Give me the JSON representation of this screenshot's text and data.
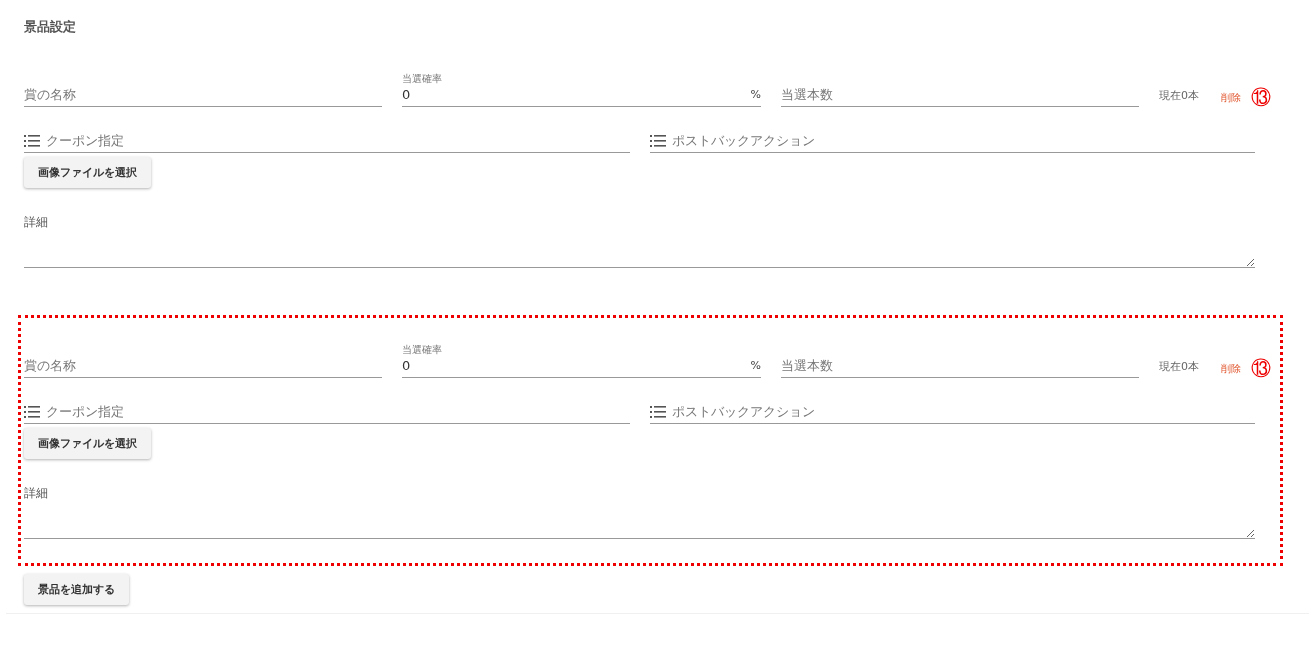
{
  "title": "景品設定",
  "prizes": [
    {
      "highlighted": false,
      "annotation": "⑬",
      "name": {
        "placeholder": "賞の名称"
      },
      "rate": {
        "label": "当選確率",
        "value": "0",
        "unit": "%"
      },
      "count": {
        "placeholder": "当選本数"
      },
      "current": "現在0本",
      "delete": "削除",
      "coupon": {
        "placeholder": "クーポン指定"
      },
      "postback": {
        "placeholder": "ポストバックアクション"
      },
      "image_button": "画像ファイルを選択",
      "detail": {
        "label": "詳細"
      }
    },
    {
      "highlighted": true,
      "annotation": "⑬",
      "name": {
        "placeholder": "賞の名称"
      },
      "rate": {
        "label": "当選確率",
        "value": "0",
        "unit": "%"
      },
      "count": {
        "placeholder": "当選本数"
      },
      "current": "現在0本",
      "delete": "削除",
      "coupon": {
        "placeholder": "クーポン指定"
      },
      "postback": {
        "placeholder": "ポストバックアクション"
      },
      "image_button": "画像ファイルを選択",
      "detail": {
        "label": "詳細"
      }
    }
  ],
  "add_button": "景品を追加する"
}
